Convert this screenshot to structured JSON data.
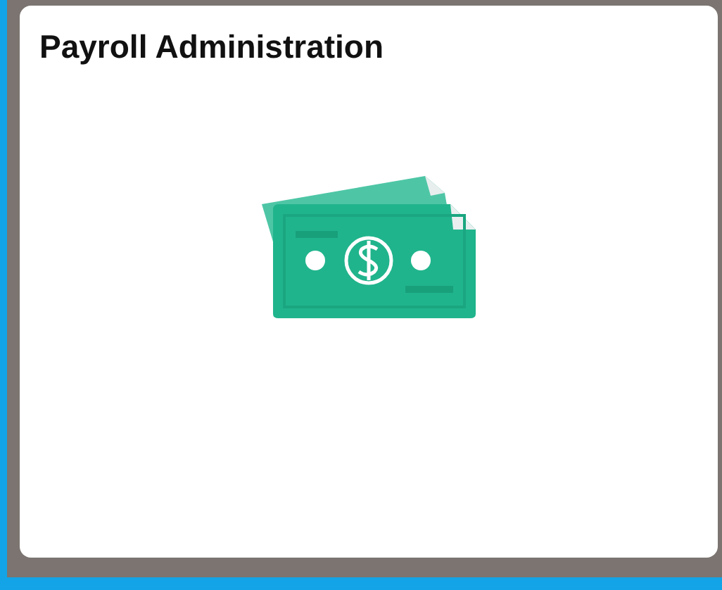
{
  "tile": {
    "title": "Payroll Administration"
  }
}
